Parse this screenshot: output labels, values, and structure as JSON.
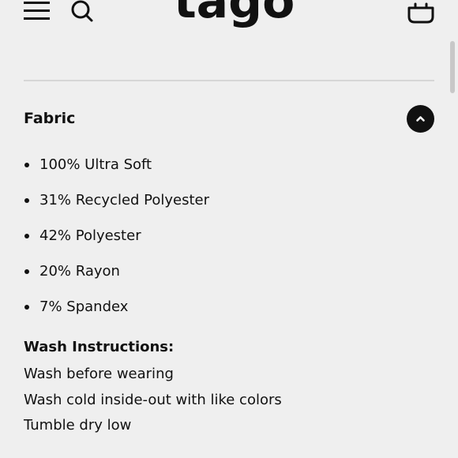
{
  "header": {
    "logo_text": "tago",
    "menu_icon": "hamburger-menu-icon",
    "search_icon": "search-icon",
    "cart_icon": "shopping-basket-icon"
  },
  "fabric": {
    "title": "Fabric",
    "toggle_icon": "chevron-up-icon",
    "items": [
      "100% Ultra Soft",
      "31% Recycled Polyester",
      "42% Polyester",
      "20% Rayon",
      "7% Spandex"
    ]
  },
  "wash": {
    "title": "Wash Instructions:",
    "lines": [
      "Wash before wearing",
      "Wash cold inside-out with like colors",
      "Tumble dry low"
    ]
  },
  "colors": {
    "background": "#efefef",
    "text": "#111111",
    "divider": "#d6d6d6",
    "toggle_bg": "#111111",
    "toggle_icon": "#ffffff",
    "scrollbar": "#c8c8c8"
  }
}
